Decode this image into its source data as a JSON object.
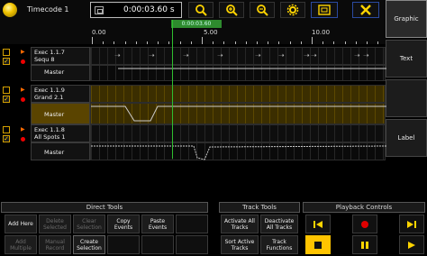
{
  "timecode": {
    "title": "Timecode 1",
    "value": "0:00:03.60 s",
    "cursor_time": "0:00:03.60"
  },
  "toolbar": {
    "icons": [
      "zoom-fit-icon",
      "zoom-in-icon",
      "zoom-out-icon",
      "settings-icon",
      "window-icon",
      "close-icon"
    ]
  },
  "right_tabs": [
    {
      "label": "Graphic",
      "active": true
    },
    {
      "label": "Text",
      "active": false
    },
    {
      "label": "",
      "active": false
    },
    {
      "label": "Label",
      "active": false
    }
  ],
  "ruler": {
    "labels": [
      "0.00",
      "5.00",
      "10.00"
    ]
  },
  "tracks": [
    {
      "exec": "Exec 1.1.7",
      "name": "Sequ 8",
      "sub": "Master",
      "amber": false
    },
    {
      "exec": "Exec 1.1.9",
      "name": "Grand 2.1",
      "sub": "Master",
      "amber": true
    },
    {
      "exec": "Exec 1.1.8",
      "name": "All Spots 1",
      "sub": "Master",
      "amber": false
    }
  ],
  "direct_tools": {
    "title": "Direct Tools",
    "buttons": [
      {
        "label": "Add Here",
        "enabled": true
      },
      {
        "label": "Delete Selected",
        "enabled": false
      },
      {
        "label": "Clear Selection",
        "enabled": false
      },
      {
        "label": "Copy Events",
        "enabled": true
      },
      {
        "label": "Paste Events",
        "enabled": true
      },
      {
        "label": "Add Multiple",
        "enabled": false
      },
      {
        "label": "Manual Record",
        "enabled": false
      },
      {
        "label": "Create Selection",
        "enabled": true
      }
    ]
  },
  "track_tools": {
    "title": "Track Tools",
    "buttons": [
      {
        "label": "Activate All Tracks"
      },
      {
        "label": "Deactivate All Tracks"
      },
      {
        "label": "Sort Active Tracks"
      },
      {
        "label": "Track Functions"
      }
    ]
  },
  "playback_controls": {
    "title": "Playback Controls",
    "buttons": [
      "skip-back-icon",
      "record-icon",
      "skip-forward-icon",
      "stop-icon",
      "pause-icon",
      "play-icon"
    ]
  },
  "colors": {
    "accent": "#ffd400",
    "cursor": "#2fbf2f",
    "amber_lane": "#3b2e00"
  }
}
